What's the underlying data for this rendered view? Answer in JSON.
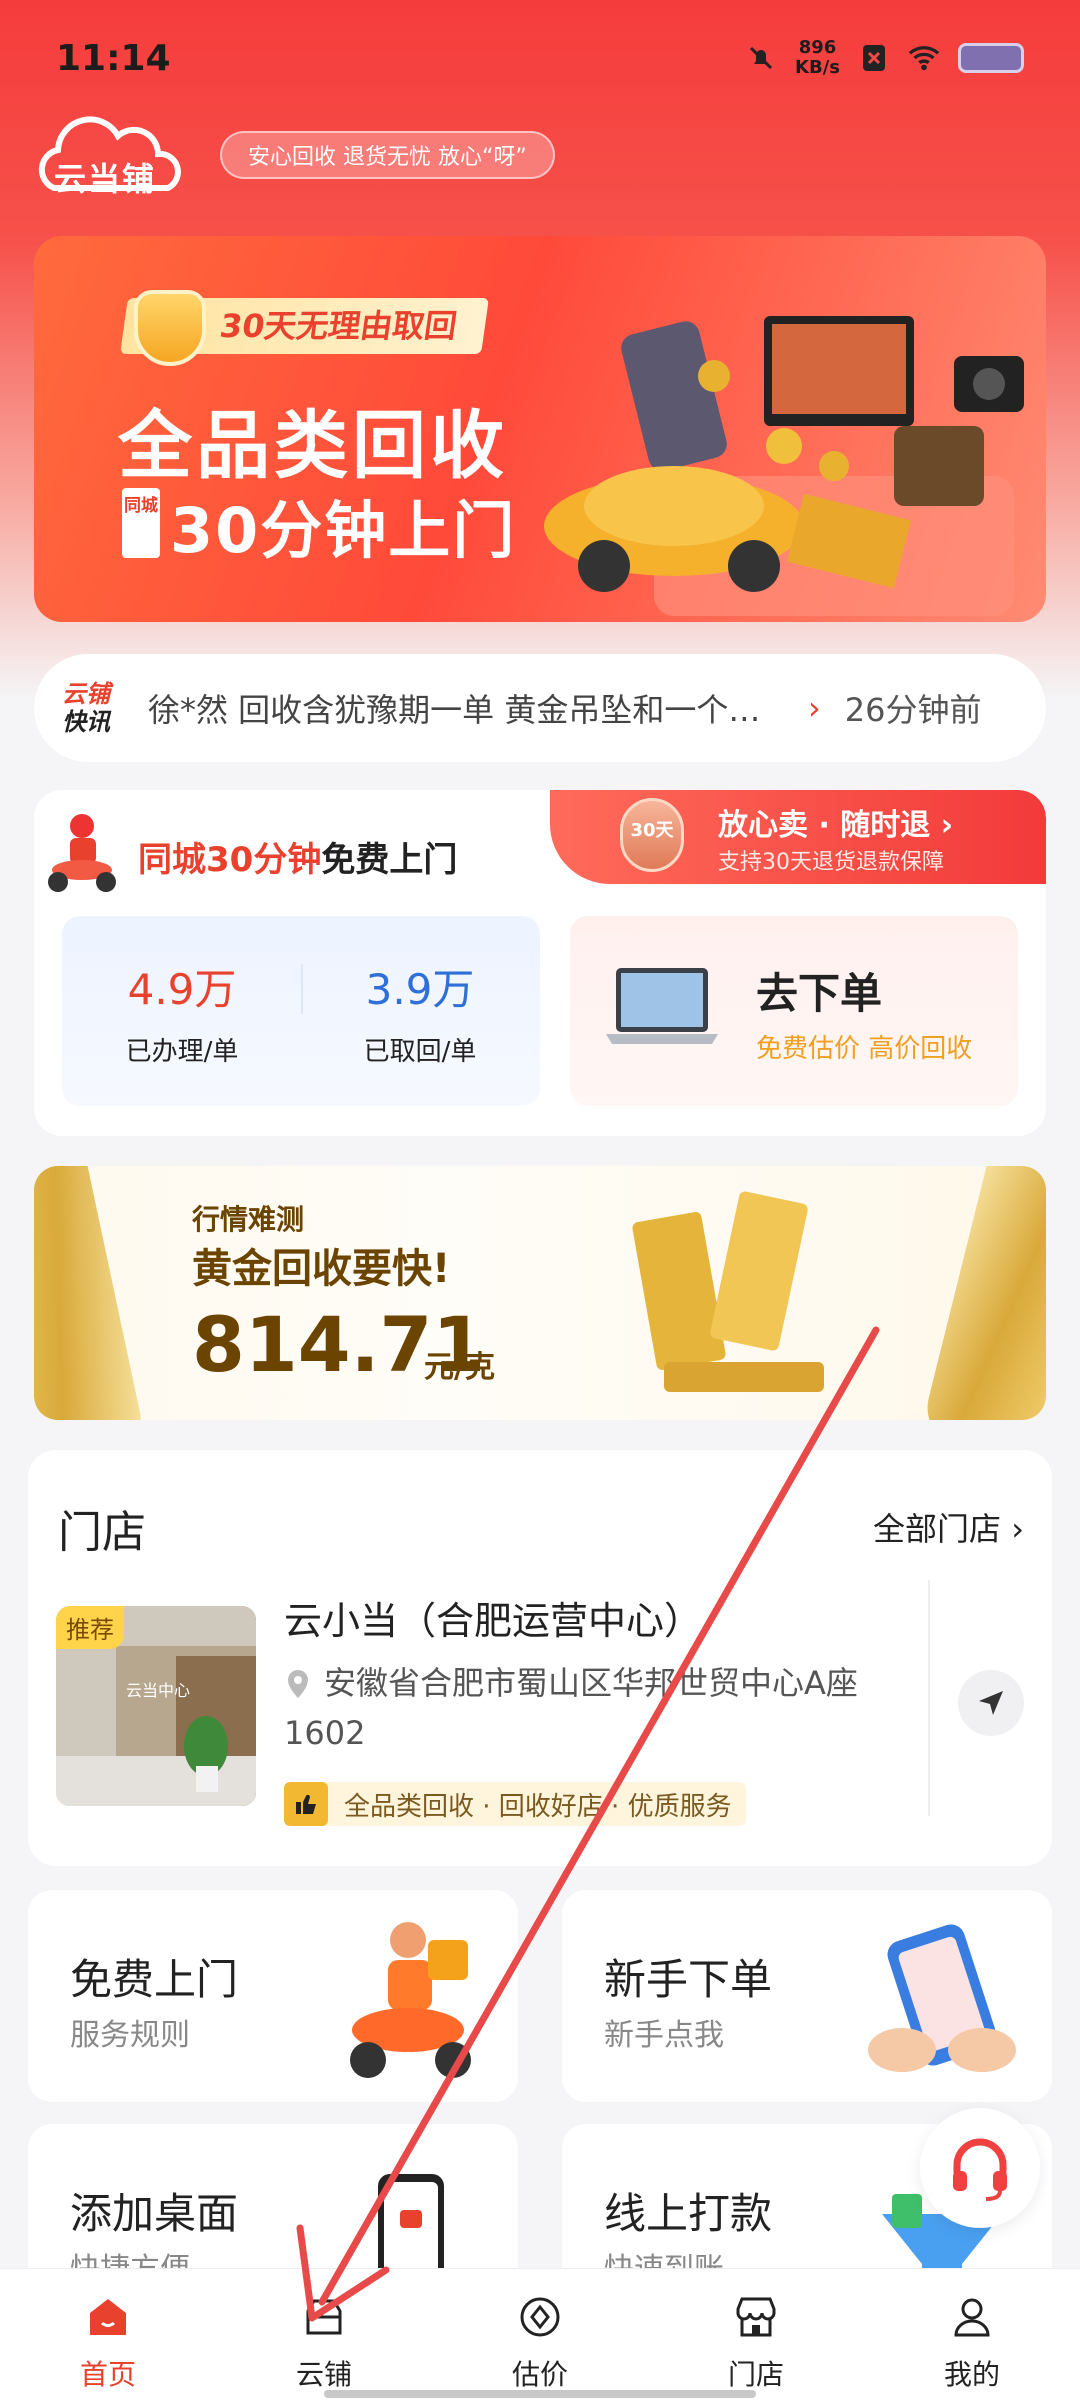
{
  "status_bar": {
    "time": "11:14",
    "net_speed_value": "896",
    "net_speed_unit": "KB/s"
  },
  "header": {
    "logo_text": "云当铺",
    "slogan": "安心回收 退货无忧 放心“呀”"
  },
  "hero": {
    "badge": "30天无理由取回",
    "title": "全品类回收",
    "sub_tag": "同城",
    "subtitle": "30分钟上门"
  },
  "ticker": {
    "logo_top": "云铺",
    "logo_bottom": "快讯",
    "text": "徐*然 回收含犹豫期一单 黄金吊坠和一个黄…",
    "time": "26分钟前"
  },
  "service": {
    "title_red": "同城30分钟",
    "title_black": "免费上门",
    "corner_title": "放心卖 · 随时退 ›",
    "corner_sub": "支持30天退货退款保障",
    "medal_text": "30天",
    "stats": [
      {
        "value": "4.9万",
        "label": "已办理/单",
        "color": "#e8412e"
      },
      {
        "value": "3.9万",
        "label": "已取回/单",
        "color": "#2f6fd8"
      }
    ],
    "order_title": "去下单",
    "order_sub": "免费估价  高价回收"
  },
  "gold": {
    "tag": "行情难测",
    "title": "黄金回收要快!",
    "price": "814.71",
    "unit": "元/克"
  },
  "store": {
    "heading": "门店",
    "all_label": "全部门店",
    "rec_tag": "推荐",
    "photo_sign": "云当中心",
    "name": "云小当（合肥运营中心）",
    "address": "安徽省合肥市蜀山区华邦世贸中心A座1602",
    "feature": "全品类回收 · 回收好店 · 优质服务"
  },
  "tiles": [
    {
      "title": "免费上门",
      "sub": "服务规则"
    },
    {
      "title": "新手下单",
      "sub": "新手点我"
    },
    {
      "title": "添加桌面",
      "sub": "快捷方便"
    },
    {
      "title": "线上打款",
      "sub": "快速到账"
    }
  ],
  "nav": [
    {
      "label": "首页",
      "icon": "home-icon",
      "active": true
    },
    {
      "label": "云铺",
      "icon": "shop-box-icon",
      "active": false
    },
    {
      "label": "估价",
      "icon": "valuation-icon",
      "active": false
    },
    {
      "label": "门店",
      "icon": "store-icon",
      "active": false
    },
    {
      "label": "我的",
      "icon": "profile-icon",
      "active": false
    }
  ],
  "colors": {
    "brand_red": "#e8412e",
    "accent_blue": "#2f6fd8",
    "gold_brown": "#6b4400",
    "annotation_red": "#e84a4a"
  }
}
